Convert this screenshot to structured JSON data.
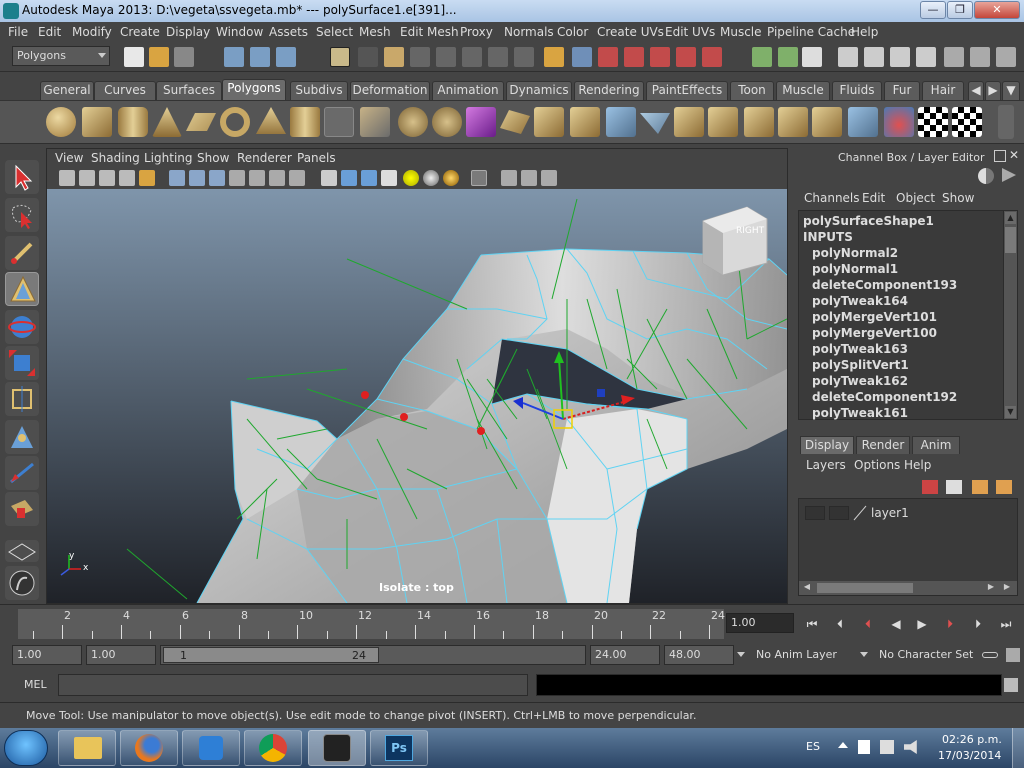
{
  "window": {
    "title": "Autodesk Maya 2013: D:\\vegeta\\ssvegeta.mb*   ---   polySurface1.e[391]...",
    "minimize": "—",
    "maximize": "❐",
    "close": "✕"
  },
  "menubar": [
    "File",
    "Edit",
    "Modify",
    "Create",
    "Display",
    "Window",
    "Assets",
    "Select",
    "Mesh",
    "Edit Mesh",
    "Proxy",
    "Normals",
    "Color",
    "Create UVs",
    "Edit UVs",
    "Muscle",
    "Pipeline Cache",
    "Help"
  ],
  "statusline": {
    "mode": "Polygons"
  },
  "shelf": {
    "tabs": [
      "General",
      "Curves",
      "Surfaces",
      "Polygons",
      "Subdivs",
      "Deformation",
      "Animation",
      "Dynamics",
      "Rendering",
      "PaintEffects",
      "Toon",
      "Muscle",
      "Fluids",
      "Fur",
      "Hair"
    ],
    "active_tab": "Polygons"
  },
  "viewport": {
    "menu": [
      "View",
      "Shading",
      "Lighting",
      "Show",
      "Renderer",
      "Panels"
    ],
    "isolate_label": "Isolate : top",
    "viewcube_face": "RIGHT",
    "axis_y": "y",
    "axis_x": "x"
  },
  "channel_box": {
    "title": "Channel Box / Layer Editor",
    "menu": [
      "Channels",
      "Edit",
      "Object",
      "Show"
    ],
    "shape": "polySurfaceShape1",
    "inputs_label": "INPUTS",
    "inputs": [
      "polyNormal2",
      "polyNormal1",
      "deleteComponent193",
      "polyTweak164",
      "polyMergeVert101",
      "polyMergeVert100",
      "polyTweak163",
      "polySplitVert1",
      "polyTweak162",
      "deleteComponent192",
      "polyTweak161"
    ]
  },
  "layer_editor": {
    "tabs": [
      "Display",
      "Render",
      "Anim"
    ],
    "active_tab": "Display",
    "menu": [
      "Layers",
      "Options",
      "Help"
    ],
    "layers": [
      {
        "name": "layer1"
      }
    ]
  },
  "time_slider": {
    "ticks": [
      "2",
      "4",
      "6",
      "8",
      "10",
      "12",
      "14",
      "16",
      "18",
      "20",
      "22",
      "24"
    ],
    "current_frame": "1.00"
  },
  "range_slider": {
    "start": "1.00",
    "playback_start": "1.00",
    "range_min": "1",
    "range_max": "24",
    "playback_end": "24.00",
    "end": "48.00",
    "anim_layer": "No Anim Layer",
    "character_set": "No Character Set"
  },
  "command_line": {
    "label": "MEL"
  },
  "help_line": "Move Tool: Use manipulator to move object(s). Use edit mode to change pivot (INSERT).  Ctrl+LMB to move perpendicular.",
  "taskbar": {
    "language": "ES",
    "time": "02:26 p.m.",
    "date": "17/03/2014"
  }
}
